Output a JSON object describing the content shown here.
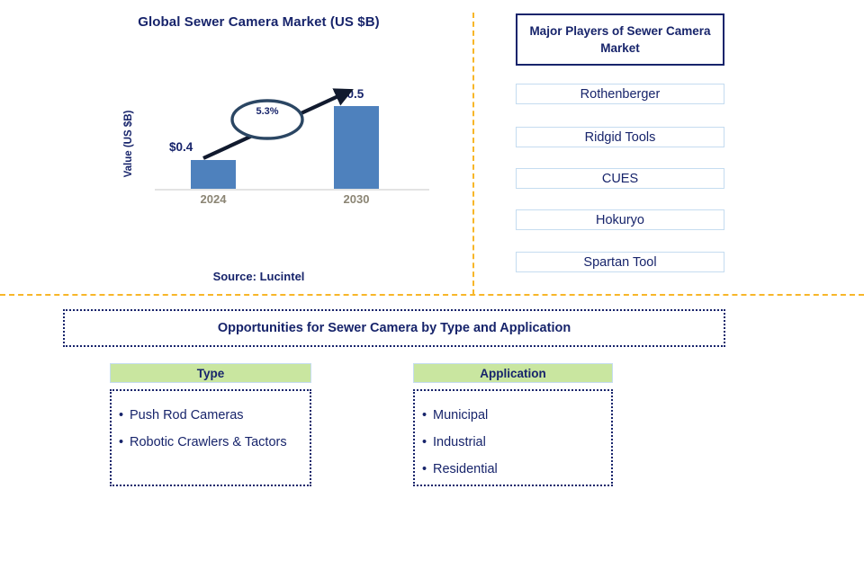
{
  "chart_panel": {
    "title": "Global Sewer Camera Market (US $B)",
    "source": "Source: Lucintel"
  },
  "chart_data": {
    "type": "bar",
    "title": "Global Sewer Camera Market (US $B)",
    "categories": [
      "2024",
      "2030"
    ],
    "values": [
      0.4,
      0.5
    ],
    "data_labels": [
      "$0.4",
      "$0.5"
    ],
    "xlabel": "",
    "ylabel": "Value (US $B)",
    "ylim": [
      0,
      0.58
    ],
    "grid": false,
    "legend": false,
    "bar_color": "#4E81BD",
    "annotation": {
      "label": "5.3%",
      "kind": "cagr-callout",
      "shape": "ellipse-with-arrow"
    }
  },
  "players_panel": {
    "header": "Major Players of Sewer Camera Market",
    "items": [
      {
        "label": "Rothenberger"
      },
      {
        "label": "Ridgid Tools"
      },
      {
        "label": "CUES"
      },
      {
        "label": "Hokuryo"
      },
      {
        "label": "Spartan Tool"
      }
    ]
  },
  "opportunities": {
    "banner": "Opportunities for Sewer Camera by Type and Application",
    "columns": [
      {
        "header": "Type",
        "items": [
          "Push Rod Cameras",
          "Robotic Crawlers & Tactors"
        ]
      },
      {
        "header": "Application",
        "items": [
          "Municipal",
          "Industrial",
          "Residential"
        ]
      }
    ]
  },
  "colors": {
    "navy": "#17246B",
    "bar_blue": "#4E81BD",
    "divider_orange": "#F7B629",
    "column_header_green": "#C9E6A0",
    "box_border_light_blue": "#C5DCF0",
    "year_label_taupe": "#8B8574"
  }
}
